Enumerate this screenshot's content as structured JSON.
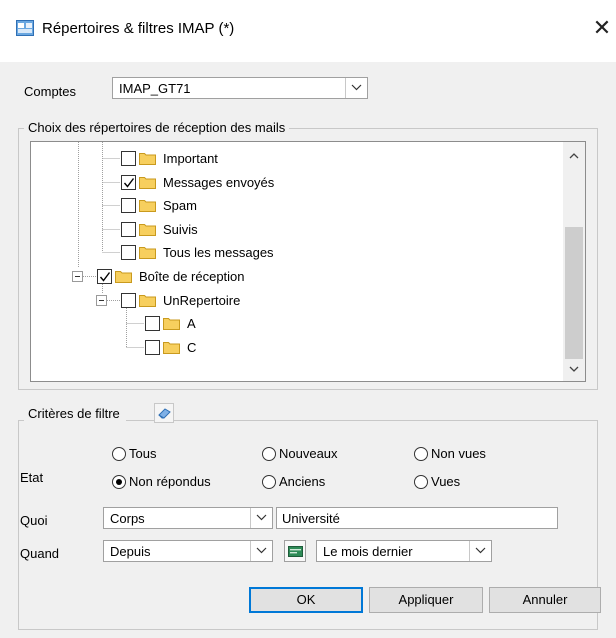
{
  "window": {
    "title": "Répertoires & filtres IMAP (*)",
    "close_glyph": "✕"
  },
  "accounts": {
    "label": "Comptes",
    "value": "IMAP_GT71"
  },
  "folders_group": {
    "title": "Choix des répertoires de réception des mails",
    "items": [
      {
        "label": "Important",
        "checked": false
      },
      {
        "label": "Messages envoyés",
        "checked": true
      },
      {
        "label": "Spam",
        "checked": false
      },
      {
        "label": "Suivis",
        "checked": false
      },
      {
        "label": "Tous les messages",
        "checked": false
      },
      {
        "label": "Boîte de réception",
        "checked": true
      },
      {
        "label": "UnRepertoire",
        "checked": false
      },
      {
        "label": "A",
        "checked": false
      },
      {
        "label": "C",
        "checked": false
      }
    ]
  },
  "filter_group": {
    "title": "Critères de filtre",
    "icon": "eraser-icon",
    "etat": {
      "label": "Etat",
      "options": [
        {
          "label": "Tous",
          "selected": false
        },
        {
          "label": "Nouveaux",
          "selected": false
        },
        {
          "label": "Non vues",
          "selected": false
        },
        {
          "label": "Non répondus",
          "selected": true
        },
        {
          "label": "Anciens",
          "selected": false
        },
        {
          "label": "Vues",
          "selected": false
        }
      ]
    },
    "quoi": {
      "label": "Quoi",
      "field": "Corps",
      "value": "Université"
    },
    "quand": {
      "label": "Quand",
      "mode": "Depuis",
      "period": "Le mois dernier"
    }
  },
  "buttons": {
    "ok": "OK",
    "apply": "Appliquer",
    "cancel": "Annuler"
  },
  "colors": {
    "folder": "#f7cf5e",
    "accent": "#0078d7",
    "dialog_bg": "#f0f0f0"
  }
}
